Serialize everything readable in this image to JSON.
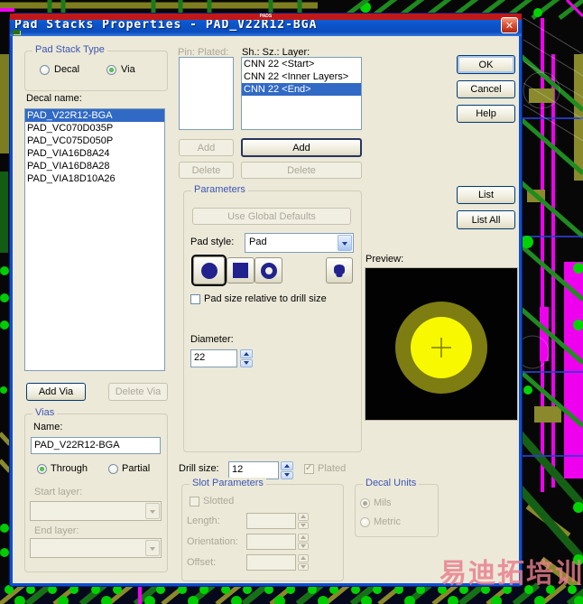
{
  "window": {
    "title": "Pad Stacks Properties - PAD_V22R12-BGA",
    "app_icon_label": "PADS",
    "close_glyph": "✕"
  },
  "pad_stack_type": {
    "label": "Pad Stack Type",
    "decal_label": "Decal",
    "via_label": "Via"
  },
  "decal_list": {
    "label": "Decal name:",
    "items": [
      "PAD_V22R12-BGA",
      "PAD_VC070D035P",
      "PAD_VC075D050P",
      "PAD_VIA16D8A24",
      "PAD_VIA16D8A28",
      "PAD_VIA18D10A26"
    ],
    "selected_index": 0
  },
  "via_buttons": {
    "add_via": "Add Via",
    "delete_via": "Delete Via"
  },
  "vias": {
    "label": "Vias",
    "name_label": "Name:",
    "name_value": "PAD_V22R12-BGA",
    "through_label": "Through",
    "partial_label": "Partial",
    "start_layer_label": "Start layer:",
    "end_layer_label": "End layer:"
  },
  "pin_section": {
    "pin_label": "Pin: Plated:",
    "layer_label": "Sh.: Sz.: Layer:",
    "layers": [
      {
        "text": "CNN 22 <Start>",
        "selected": false
      },
      {
        "text": "CNN 22 <Inner Layers>",
        "selected": false
      },
      {
        "text": "CNN 22 <End>",
        "selected": true
      }
    ],
    "pin_add": "Add",
    "pin_delete": "Delete",
    "layer_add": "Add",
    "layer_delete": "Delete"
  },
  "parameters": {
    "label": "Parameters",
    "use_global_defaults": "Use Global Defaults",
    "pad_style_label": "Pad style:",
    "pad_style_value": "Pad",
    "relative_checkbox_label": "Pad size relative to drill size",
    "diameter_label": "Diameter:",
    "diameter_value": "22"
  },
  "drill": {
    "label": "Drill size:",
    "value": "12",
    "plated_label": "Plated"
  },
  "slot": {
    "label": "Slot Parameters",
    "slotted_label": "Slotted",
    "length_label": "Length:",
    "orientation_label": "Orientation:",
    "offset_label": "Offset:"
  },
  "decal_units": {
    "label": "Decal Units",
    "mils_label": "Mils",
    "metric_label": "Metric"
  },
  "action_buttons": {
    "ok": "OK",
    "cancel": "Cancel",
    "help": "Help",
    "list": "List",
    "list_all": "List All"
  },
  "preview": {
    "label": "Preview:"
  },
  "watermark_text": "易迪拓培训",
  "colors": {
    "selection_blue": "#316ac5",
    "titlebar_blue": "#0d55cc",
    "pad_shape_navy": "#22228e",
    "preview_outer_ring": "#7d7d12",
    "preview_inner_pad": "#f8f800",
    "watermark_pink": "#e87d8c",
    "pcb_trace_green": "#1f8c1f",
    "pcb_via_green": "#00d400",
    "pcb_magenta": "#f000f0"
  }
}
